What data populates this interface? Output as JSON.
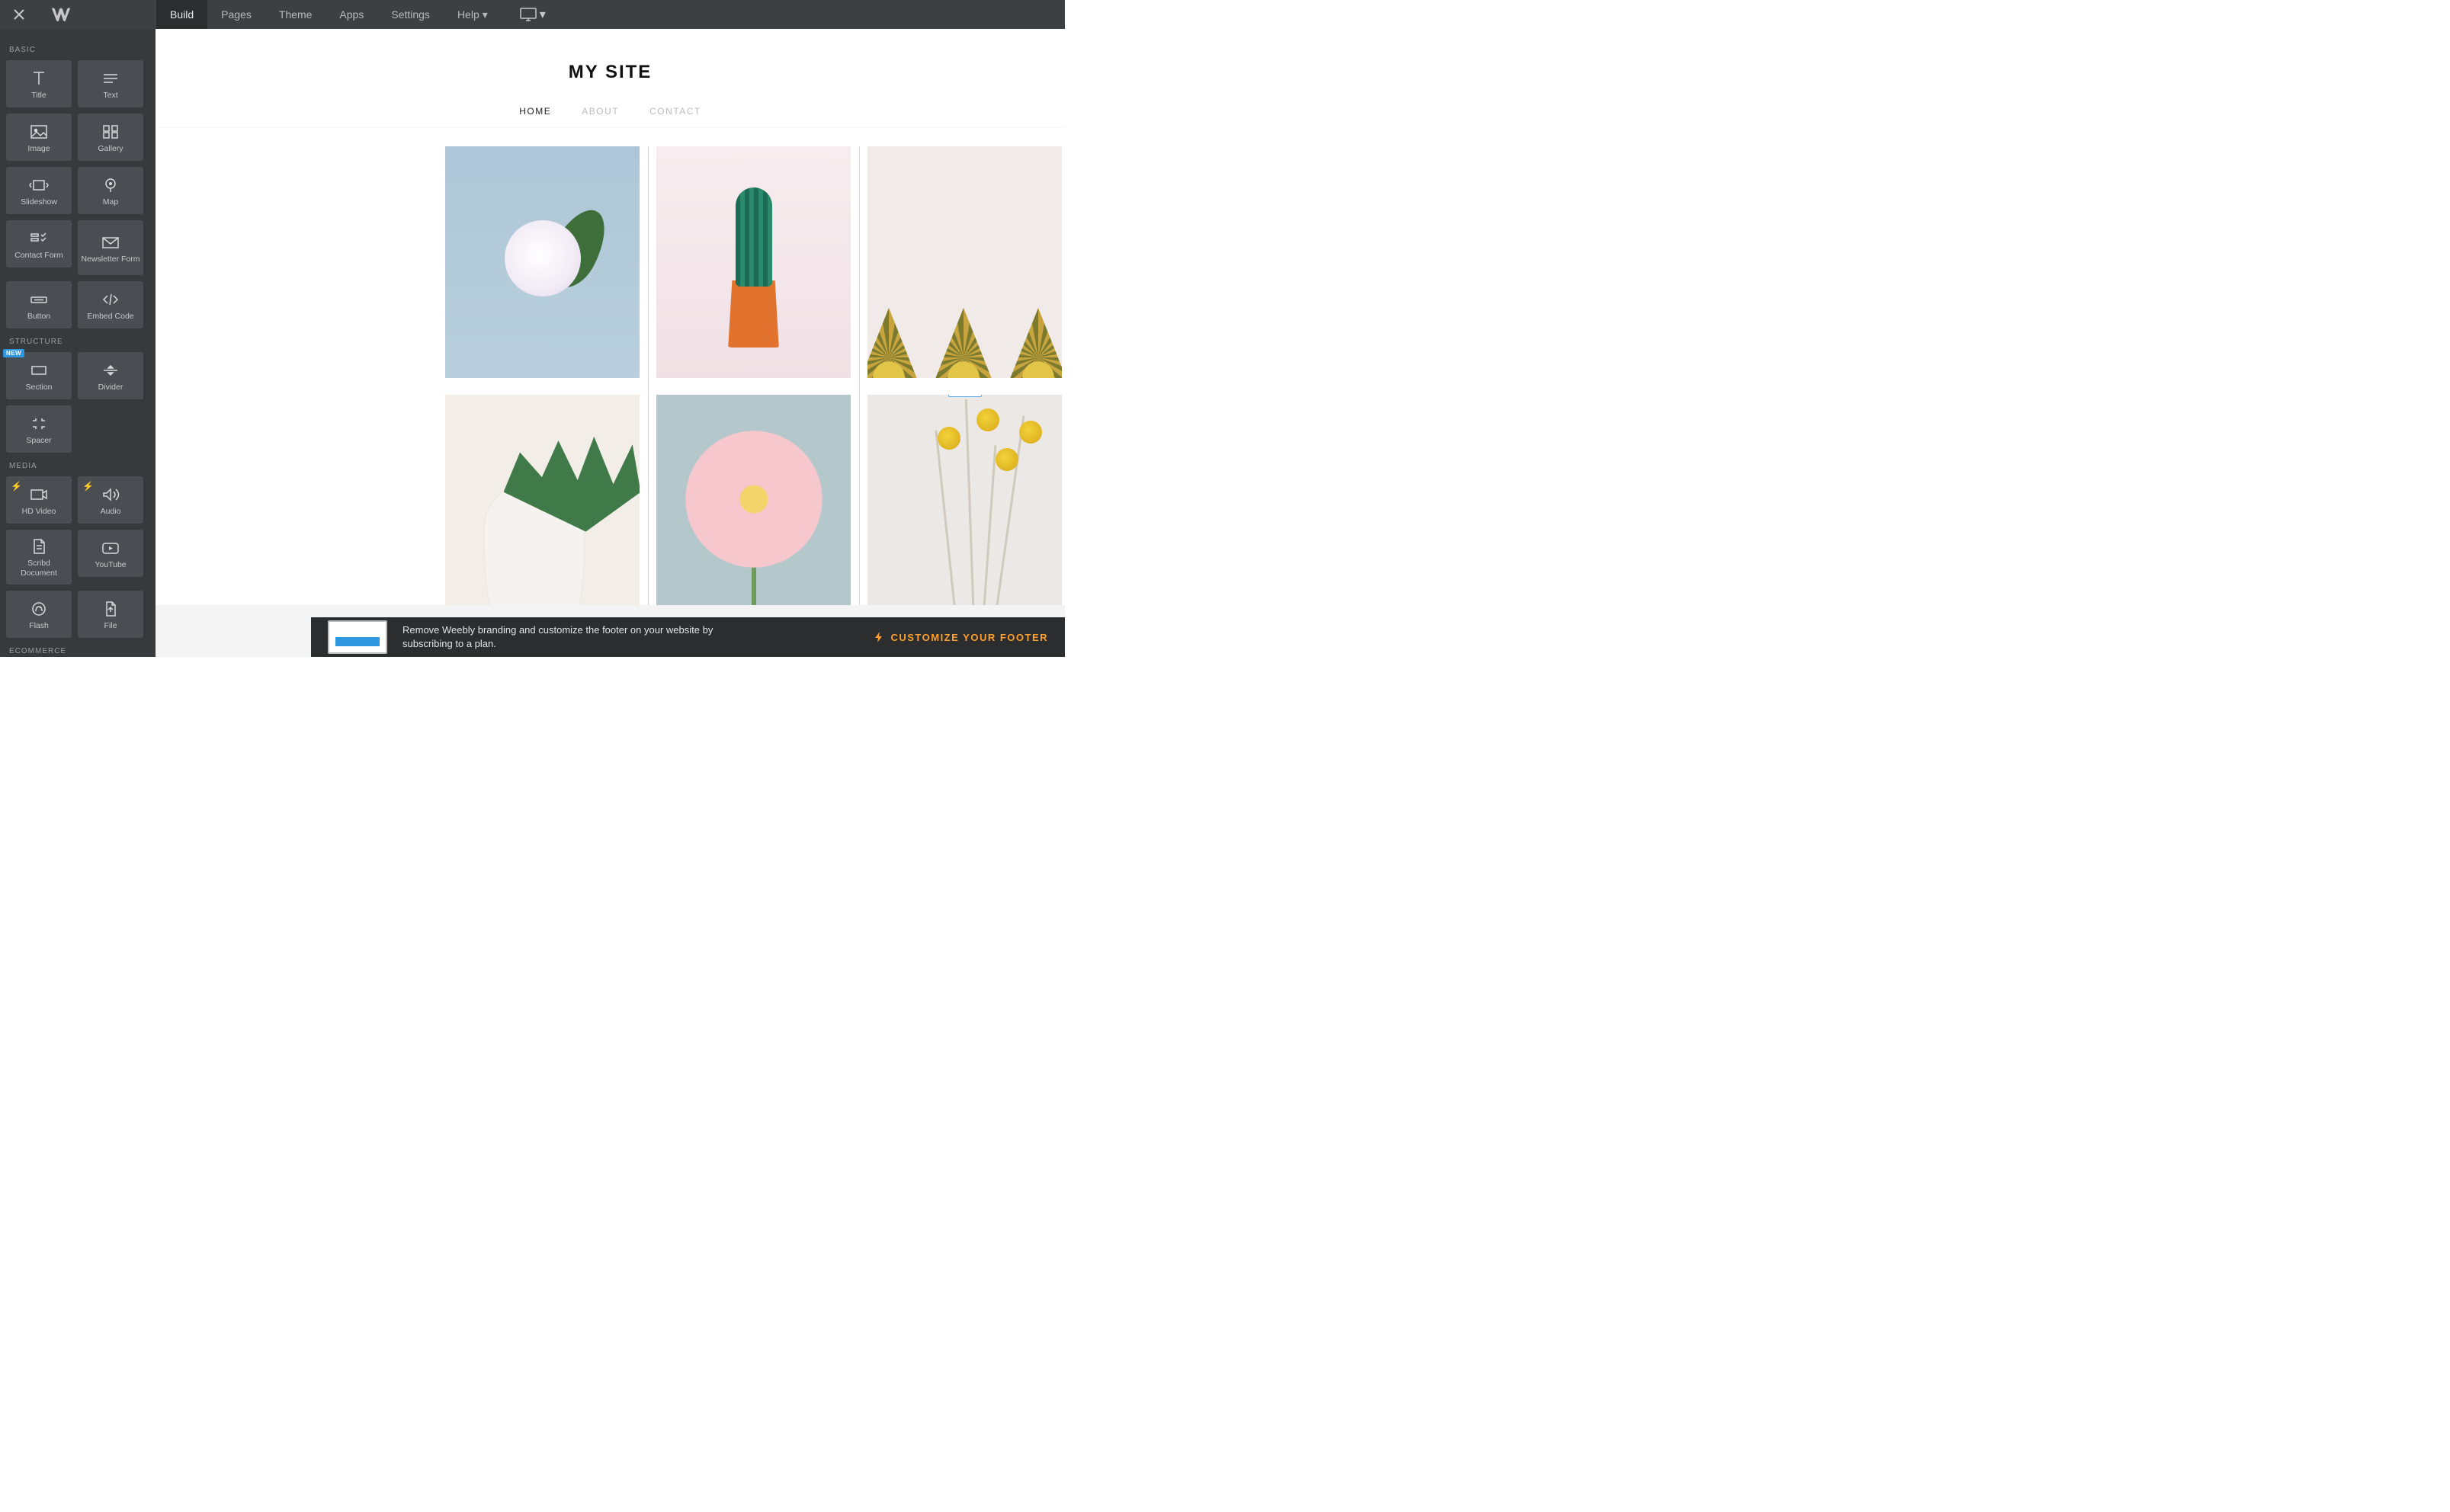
{
  "topbar": {
    "tabs": [
      {
        "label": "Build",
        "active": true
      },
      {
        "label": "Pages"
      },
      {
        "label": "Theme"
      },
      {
        "label": "Apps"
      },
      {
        "label": "Settings"
      },
      {
        "label": "Help",
        "caret": true
      }
    ]
  },
  "sidebar": {
    "sections": [
      {
        "heading": "BASIC",
        "items": [
          {
            "label": "Title",
            "icon": "title-icon"
          },
          {
            "label": "Text",
            "icon": "text-icon"
          },
          {
            "label": "Image",
            "icon": "image-icon"
          },
          {
            "label": "Gallery",
            "icon": "gallery-icon"
          },
          {
            "label": "Slideshow",
            "icon": "slideshow-icon"
          },
          {
            "label": "Map",
            "icon": "map-icon"
          },
          {
            "label": "Contact Form",
            "icon": "contact-form-icon"
          },
          {
            "label": "Newsletter Form",
            "icon": "newsletter-icon"
          },
          {
            "label": "Button",
            "icon": "button-icon"
          },
          {
            "label": "Embed Code",
            "icon": "embed-code-icon"
          }
        ]
      },
      {
        "heading": "STRUCTURE",
        "items": [
          {
            "label": "Section",
            "icon": "section-icon",
            "badge": "NEW"
          },
          {
            "label": "Divider",
            "icon": "divider-icon"
          },
          {
            "label": "Spacer",
            "icon": "spacer-icon"
          }
        ]
      },
      {
        "heading": "MEDIA",
        "items": [
          {
            "label": "HD Video",
            "icon": "hd-video-icon",
            "lightning": true
          },
          {
            "label": "Audio",
            "icon": "audio-icon",
            "lightning": true
          },
          {
            "label": "Scribd Document",
            "icon": "scribd-icon"
          },
          {
            "label": "YouTube",
            "icon": "youtube-icon"
          },
          {
            "label": "Flash",
            "icon": "flash-icon"
          },
          {
            "label": "File",
            "icon": "file-icon"
          }
        ]
      },
      {
        "heading": "ECOMMERCE",
        "items": []
      }
    ]
  },
  "site": {
    "title": "MY SITE",
    "nav": [
      {
        "label": "HOME",
        "active": true
      },
      {
        "label": "ABOUT"
      },
      {
        "label": "CONTACT"
      }
    ]
  },
  "footer": {
    "message": "Remove Weebly branding and customize the footer on your website by subscribing to a plan.",
    "cta": "CUSTOMIZE YOUR FOOTER"
  }
}
